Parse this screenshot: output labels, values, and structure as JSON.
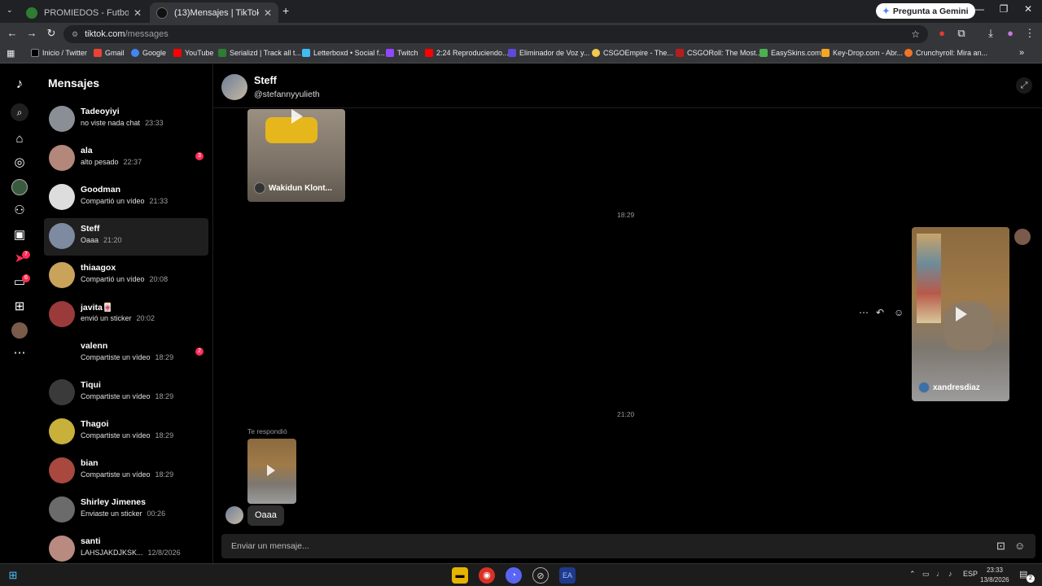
{
  "browser": {
    "tabs": [
      {
        "title": "PROMIEDOS - Futbol Argentino",
        "active": false
      },
      {
        "title": "(13)Mensajes | TikTok",
        "active": true
      }
    ],
    "new_tab": "+",
    "gemini_label": "Pregunta a Gemini",
    "url_domain": "tiktok.com",
    "url_path": "/messages",
    "bookmarks": [
      "Inicio / Twitter",
      "Gmail",
      "Google",
      "YouTube",
      "Serializd | Track all t...",
      "Letterboxd • Social f...",
      "Twitch",
      "2:24 Reproduciendo...",
      "Eliminador de Voz y...",
      "CSGOEmpire - The...",
      "CSGORoll: The Most...",
      "EasySkins.com",
      "Key-Drop.com - Abr...",
      "Crunchyroll: Mira an..."
    ]
  },
  "rail": {
    "badges": {
      "inbox": "7",
      "messages": "6"
    }
  },
  "inbox": {
    "title": "Mensajes",
    "conversations": [
      {
        "name": "Tadeoyiyi",
        "preview": "no viste nada chat",
        "time": "23:33",
        "badge": ""
      },
      {
        "name": "ala",
        "preview": "alto pesado",
        "time": "22:37",
        "badge": "3"
      },
      {
        "name": "Goodman",
        "preview": "Compartió un vídeo",
        "time": "21:33",
        "badge": ""
      },
      {
        "name": "Steff",
        "preview": "Oaaa",
        "time": "21:20",
        "badge": ""
      },
      {
        "name": "thiaagox",
        "preview": "Compartió un vídeo",
        "time": "20:08",
        "badge": ""
      },
      {
        "name": "javita🀄",
        "preview": "envió un sticker",
        "time": "20:02",
        "badge": ""
      },
      {
        "name": "valenn",
        "preview": "Compartiste un vídeo",
        "time": "18:29",
        "badge": "2"
      },
      {
        "name": "Tiqui",
        "preview": "Compartiste un vídeo",
        "time": "18:29",
        "badge": ""
      },
      {
        "name": "Thagoi",
        "preview": "Compartiste un vídeo",
        "time": "18:29",
        "badge": ""
      },
      {
        "name": "bian",
        "preview": "Compartiste un vídeo",
        "time": "18:29",
        "badge": ""
      },
      {
        "name": "Shirley Jimenes",
        "preview": "Enviaste un sticker",
        "time": "00:26",
        "badge": ""
      },
      {
        "name": "santi",
        "preview": "LAHSJAKDJKSK...",
        "time": "12/8/2026",
        "badge": ""
      }
    ]
  },
  "chat": {
    "name": "Steff",
    "handle": "@stefannyyulieth",
    "video1_caption": "Wakidun Klont...",
    "time1": "18:29",
    "video2_caption": "xandresdiaz",
    "time2": "21:20",
    "replied_label": "Te respondió",
    "last_message": "Oaaa",
    "composer_placeholder": "Enviar un mensaje..."
  },
  "taskbar": {
    "lang": "ESP",
    "time": "23:33",
    "date": "13/8/2026",
    "notif_count": "2"
  },
  "colors": {
    "accent": "#fe2c55",
    "bg": "#000000",
    "panel": "#1f1f1f"
  }
}
